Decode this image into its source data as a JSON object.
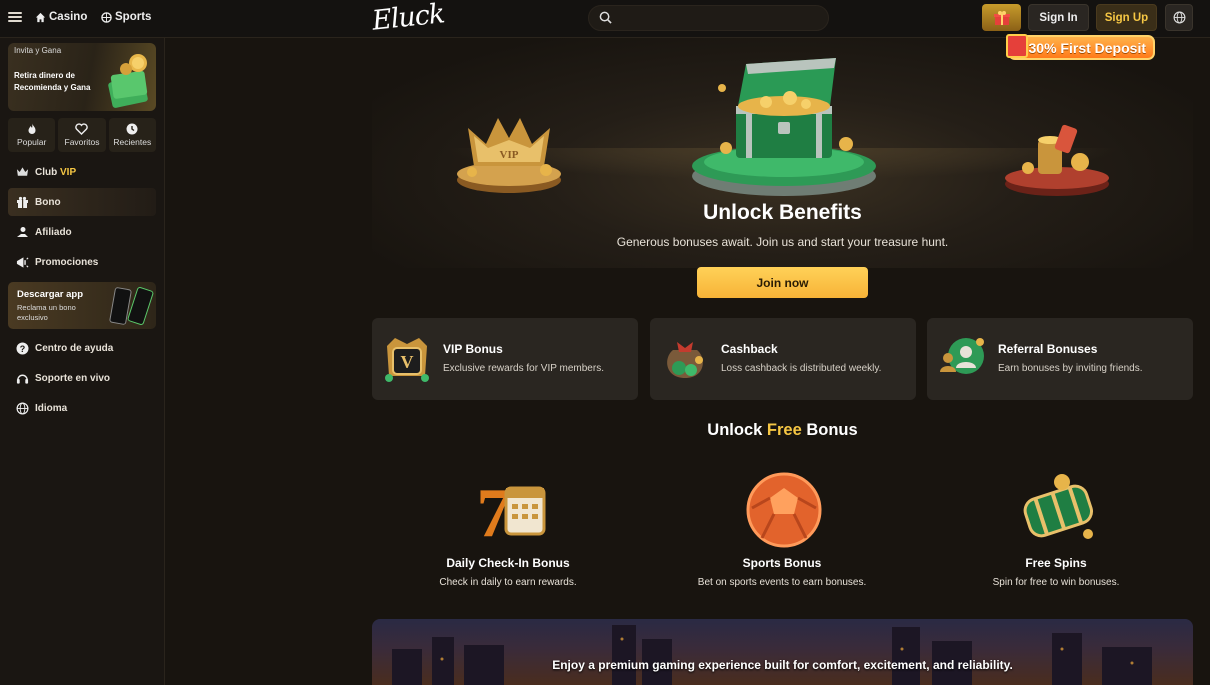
{
  "header": {
    "nav": {
      "casino": "Casino",
      "sports": "Sports"
    },
    "logo_text": "Eluck",
    "search": {
      "value": "",
      "placeholder": ""
    },
    "sign_in": "Sign In",
    "sign_up": "Sign Up",
    "deposit_banner": "30% First Deposit"
  },
  "sidebar": {
    "invite": {
      "title": "Invita y Gana",
      "text": "Retira dinero de Recomienda y Gana"
    },
    "quick": [
      {
        "label": "Popular",
        "icon": "fire-icon"
      },
      {
        "label": "Favoritos",
        "icon": "heart-icon"
      },
      {
        "label": "Recientes",
        "icon": "clock-icon"
      }
    ],
    "vip": {
      "prefix": "Club",
      "accent": "VIP"
    },
    "items": [
      {
        "label": "Bono",
        "icon": "gift-icon"
      },
      {
        "label": "Afiliado",
        "icon": "affiliate-icon"
      },
      {
        "label": "Promociones",
        "icon": "megaphone-icon"
      }
    ],
    "app": {
      "title": "Descargar app",
      "sub": "Reclama un bono exclusivo"
    },
    "support": [
      {
        "label": "Centro de ayuda",
        "icon": "help-icon"
      },
      {
        "label": "Soporte en vivo",
        "icon": "headset-icon"
      },
      {
        "label": "Idioma",
        "icon": "globe-icon"
      }
    ]
  },
  "hero": {
    "title": "Unlock Benefits",
    "subtitle": "Generous bonuses await. Join us and start your treasure hunt.",
    "cta": "Join now"
  },
  "benefits": [
    {
      "title": "VIP Bonus",
      "desc": "Exclusive rewards for VIP members."
    },
    {
      "title": "Cashback",
      "desc": "Loss cashback is distributed weekly."
    },
    {
      "title": "Referral Bonuses",
      "desc": "Earn bonuses by inviting friends."
    }
  ],
  "free": {
    "title_prefix": "Unlock",
    "title_accent": "Free",
    "title_suffix": "Bonus",
    "items": [
      {
        "title": "Daily Check-In Bonus",
        "desc": "Check in daily to earn rewards."
      },
      {
        "title": "Sports Bonus",
        "desc": "Bet on sports events to earn bonuses."
      },
      {
        "title": "Free Spins",
        "desc": "Spin for free to win bonuses."
      }
    ]
  },
  "footer_banner": "Enjoy a premium gaming experience built for comfort, excitement, and reliability.",
  "colors": {
    "accent": "#f6c744",
    "button": "#f7b337",
    "background": "#18140f",
    "card": "#2a2621"
  }
}
